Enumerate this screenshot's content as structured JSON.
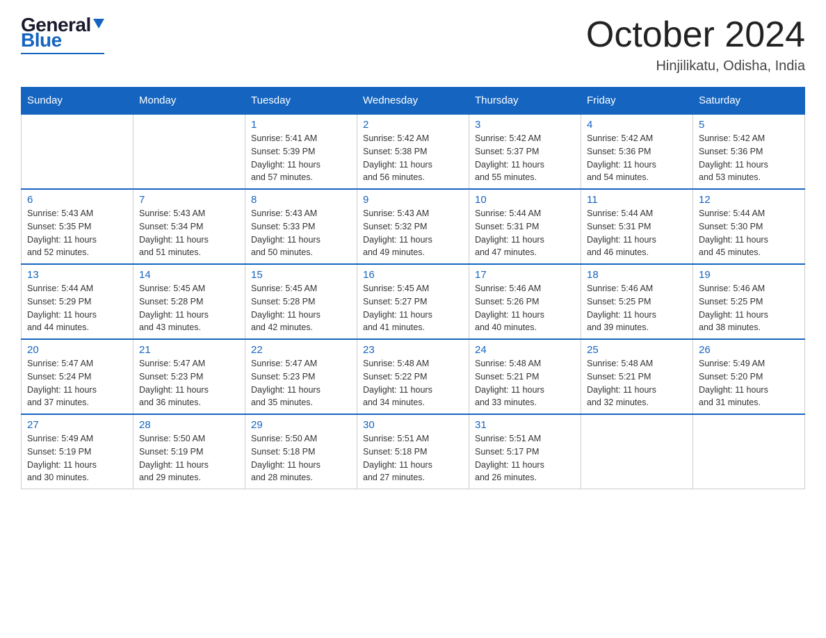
{
  "header": {
    "logo_general": "General",
    "logo_blue": "Blue",
    "month_title": "October 2024",
    "location": "Hinjilikatu, Odisha, India"
  },
  "days_of_week": [
    "Sunday",
    "Monday",
    "Tuesday",
    "Wednesday",
    "Thursday",
    "Friday",
    "Saturday"
  ],
  "weeks": [
    [
      {
        "day": "",
        "info": ""
      },
      {
        "day": "",
        "info": ""
      },
      {
        "day": "1",
        "info": "Sunrise: 5:41 AM\nSunset: 5:39 PM\nDaylight: 11 hours\nand 57 minutes."
      },
      {
        "day": "2",
        "info": "Sunrise: 5:42 AM\nSunset: 5:38 PM\nDaylight: 11 hours\nand 56 minutes."
      },
      {
        "day": "3",
        "info": "Sunrise: 5:42 AM\nSunset: 5:37 PM\nDaylight: 11 hours\nand 55 minutes."
      },
      {
        "day": "4",
        "info": "Sunrise: 5:42 AM\nSunset: 5:36 PM\nDaylight: 11 hours\nand 54 minutes."
      },
      {
        "day": "5",
        "info": "Sunrise: 5:42 AM\nSunset: 5:36 PM\nDaylight: 11 hours\nand 53 minutes."
      }
    ],
    [
      {
        "day": "6",
        "info": "Sunrise: 5:43 AM\nSunset: 5:35 PM\nDaylight: 11 hours\nand 52 minutes."
      },
      {
        "day": "7",
        "info": "Sunrise: 5:43 AM\nSunset: 5:34 PM\nDaylight: 11 hours\nand 51 minutes."
      },
      {
        "day": "8",
        "info": "Sunrise: 5:43 AM\nSunset: 5:33 PM\nDaylight: 11 hours\nand 50 minutes."
      },
      {
        "day": "9",
        "info": "Sunrise: 5:43 AM\nSunset: 5:32 PM\nDaylight: 11 hours\nand 49 minutes."
      },
      {
        "day": "10",
        "info": "Sunrise: 5:44 AM\nSunset: 5:31 PM\nDaylight: 11 hours\nand 47 minutes."
      },
      {
        "day": "11",
        "info": "Sunrise: 5:44 AM\nSunset: 5:31 PM\nDaylight: 11 hours\nand 46 minutes."
      },
      {
        "day": "12",
        "info": "Sunrise: 5:44 AM\nSunset: 5:30 PM\nDaylight: 11 hours\nand 45 minutes."
      }
    ],
    [
      {
        "day": "13",
        "info": "Sunrise: 5:44 AM\nSunset: 5:29 PM\nDaylight: 11 hours\nand 44 minutes."
      },
      {
        "day": "14",
        "info": "Sunrise: 5:45 AM\nSunset: 5:28 PM\nDaylight: 11 hours\nand 43 minutes."
      },
      {
        "day": "15",
        "info": "Sunrise: 5:45 AM\nSunset: 5:28 PM\nDaylight: 11 hours\nand 42 minutes."
      },
      {
        "day": "16",
        "info": "Sunrise: 5:45 AM\nSunset: 5:27 PM\nDaylight: 11 hours\nand 41 minutes."
      },
      {
        "day": "17",
        "info": "Sunrise: 5:46 AM\nSunset: 5:26 PM\nDaylight: 11 hours\nand 40 minutes."
      },
      {
        "day": "18",
        "info": "Sunrise: 5:46 AM\nSunset: 5:25 PM\nDaylight: 11 hours\nand 39 minutes."
      },
      {
        "day": "19",
        "info": "Sunrise: 5:46 AM\nSunset: 5:25 PM\nDaylight: 11 hours\nand 38 minutes."
      }
    ],
    [
      {
        "day": "20",
        "info": "Sunrise: 5:47 AM\nSunset: 5:24 PM\nDaylight: 11 hours\nand 37 minutes."
      },
      {
        "day": "21",
        "info": "Sunrise: 5:47 AM\nSunset: 5:23 PM\nDaylight: 11 hours\nand 36 minutes."
      },
      {
        "day": "22",
        "info": "Sunrise: 5:47 AM\nSunset: 5:23 PM\nDaylight: 11 hours\nand 35 minutes."
      },
      {
        "day": "23",
        "info": "Sunrise: 5:48 AM\nSunset: 5:22 PM\nDaylight: 11 hours\nand 34 minutes."
      },
      {
        "day": "24",
        "info": "Sunrise: 5:48 AM\nSunset: 5:21 PM\nDaylight: 11 hours\nand 33 minutes."
      },
      {
        "day": "25",
        "info": "Sunrise: 5:48 AM\nSunset: 5:21 PM\nDaylight: 11 hours\nand 32 minutes."
      },
      {
        "day": "26",
        "info": "Sunrise: 5:49 AM\nSunset: 5:20 PM\nDaylight: 11 hours\nand 31 minutes."
      }
    ],
    [
      {
        "day": "27",
        "info": "Sunrise: 5:49 AM\nSunset: 5:19 PM\nDaylight: 11 hours\nand 30 minutes."
      },
      {
        "day": "28",
        "info": "Sunrise: 5:50 AM\nSunset: 5:19 PM\nDaylight: 11 hours\nand 29 minutes."
      },
      {
        "day": "29",
        "info": "Sunrise: 5:50 AM\nSunset: 5:18 PM\nDaylight: 11 hours\nand 28 minutes."
      },
      {
        "day": "30",
        "info": "Sunrise: 5:51 AM\nSunset: 5:18 PM\nDaylight: 11 hours\nand 27 minutes."
      },
      {
        "day": "31",
        "info": "Sunrise: 5:51 AM\nSunset: 5:17 PM\nDaylight: 11 hours\nand 26 minutes."
      },
      {
        "day": "",
        "info": ""
      },
      {
        "day": "",
        "info": ""
      }
    ]
  ]
}
